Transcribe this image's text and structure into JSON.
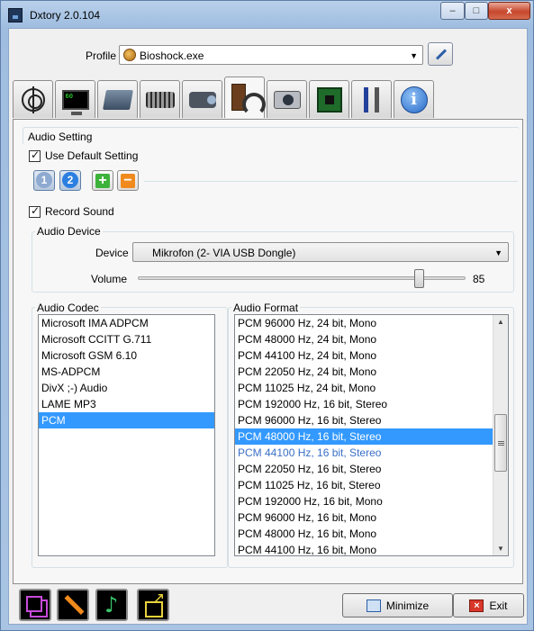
{
  "window": {
    "title": "Dxtory 2.0.104",
    "controls": {
      "minimize": "–",
      "maximize": "□",
      "close": "x"
    }
  },
  "profile": {
    "label": "Profile",
    "value": "Bioshock.exe",
    "edit_icon": "pencil-icon"
  },
  "tabs": [
    {
      "name": "target",
      "icon": "crosshair-icon"
    },
    {
      "name": "overlay",
      "icon": "monitor-icon"
    },
    {
      "name": "folder",
      "icon": "folder-icon"
    },
    {
      "name": "hotkey",
      "icon": "keyboard-icon"
    },
    {
      "name": "movie",
      "icon": "camcorder-icon"
    },
    {
      "name": "audio",
      "icon": "speaker-headphones-icon",
      "active": true
    },
    {
      "name": "screenshot",
      "icon": "camera-icon"
    },
    {
      "name": "advanced",
      "icon": "chip-icon"
    },
    {
      "name": "settings",
      "icon": "tools-icon"
    },
    {
      "name": "info",
      "icon": "info-icon"
    }
  ],
  "audio_setting": {
    "label": "Audio Setting",
    "use_default": {
      "label": "Use Default Setting",
      "checked": true
    },
    "sources": [
      "1",
      "2"
    ],
    "selected_source": "2",
    "record_sound": {
      "label": "Record Sound",
      "checked": true
    }
  },
  "audio_device": {
    "label": "Audio Device",
    "device_label": "Device",
    "device_value": "Mikrofon (2- VIA USB Dongle)",
    "volume_label": "Volume",
    "volume_value": "85",
    "volume_fraction": 0.85
  },
  "audio_codec": {
    "label": "Audio Codec",
    "items": [
      "Microsoft IMA ADPCM",
      "Microsoft CCITT G.711",
      "Microsoft GSM 6.10",
      "MS-ADPCM",
      "DivX ;-) Audio",
      "LAME MP3",
      "PCM"
    ],
    "selected": "PCM"
  },
  "audio_format": {
    "label": "Audio Format",
    "items": [
      "PCM 96000 Hz, 24 bit, Mono",
      "PCM 48000 Hz, 24 bit, Mono",
      "PCM 44100 Hz, 24 bit, Mono",
      "PCM 22050 Hz, 24 bit, Mono",
      "PCM 11025 Hz, 24 bit, Mono",
      "PCM 192000 Hz, 16 bit, Stereo",
      "PCM 96000 Hz, 16 bit, Stereo",
      "PCM 48000 Hz, 16 bit, Stereo",
      "PCM 44100 Hz, 16 bit, Stereo",
      "PCM 22050 Hz, 16 bit, Stereo",
      "PCM 11025 Hz, 16 bit, Stereo",
      "PCM 192000 Hz, 16 bit, Mono",
      "PCM 96000 Hz, 16 bit, Mono",
      "PCM 48000 Hz, 16 bit, Mono",
      "PCM 44100 Hz, 16 bit, Mono"
    ],
    "selected": "PCM 48000 Hz, 16 bit, Stereo",
    "hovered": "PCM 44100 Hz, 16 bit, Stereo"
  },
  "bottom_bar": {
    "icons": [
      "movie-mode-icon",
      "settings-mode-icon",
      "audio-mode-icon",
      "export-icon"
    ],
    "minimize_label": "Minimize",
    "exit_label": "Exit"
  },
  "colors": {
    "selection": "#3399ff",
    "hover_text": "#3a6fc7",
    "titlebar": "#b8d0ea"
  }
}
